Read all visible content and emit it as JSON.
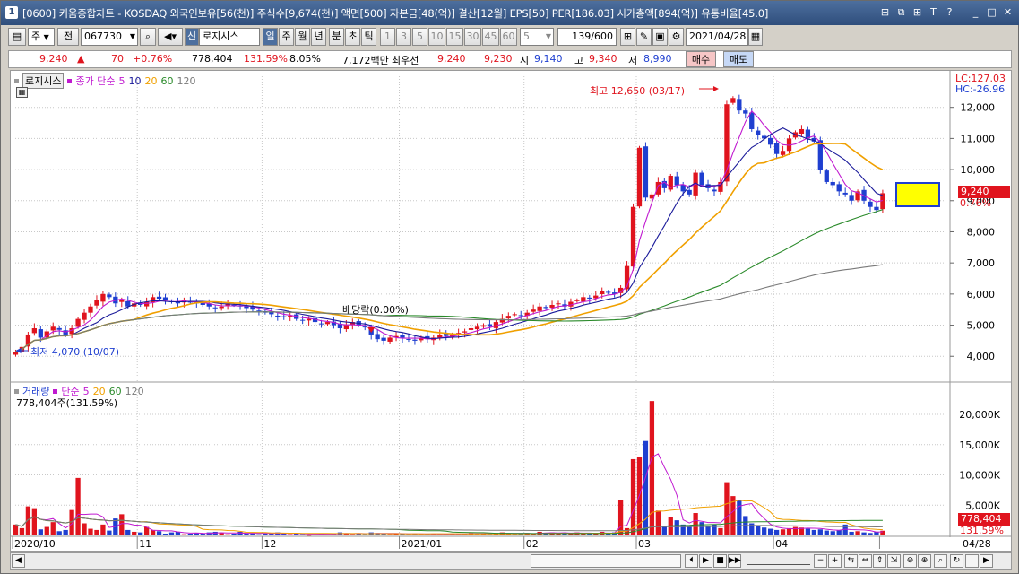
{
  "window": {
    "icon_label": "1",
    "title": "[0600] 키움종합차트 - KOSDAQ 외국인보유[56(천)] 주식수[9,674(천)] 액면[500] 자본금[48(억)] 결산[12월] EPS[50] PER[186.03] 시가총액[894(억)] 유통비율[45.0]",
    "title_buttons": [
      "⊟",
      "⧉",
      "⊞",
      "T",
      "?",
      "_",
      "□",
      "✕"
    ]
  },
  "toolbar": {
    "market_label": "주",
    "prev_label": "전",
    "code_value": "067730",
    "stock_name": "로지시스",
    "new_label": "신",
    "period_buttons": [
      "일",
      "주",
      "월",
      "년",
      "분",
      "초",
      "틱"
    ],
    "minute_buttons": [
      "1",
      "3",
      "5",
      "10",
      "15",
      "30",
      "45",
      "60"
    ],
    "count_value": "5",
    "range_value": "139/600",
    "date_value": "2021/04/28"
  },
  "quote": {
    "price": "9,240",
    "arrow": "▲",
    "change": "70",
    "change_pct": "+0.76%",
    "volume": "778,404",
    "volume_ratio": "131.59%",
    "turnover": "8.05%",
    "amount": "7,172백만",
    "bid_label": "최우선",
    "bid_sell": "9,240",
    "bid_buy": "9,230",
    "open_label": "시",
    "open": "9,140",
    "high_label": "고",
    "high": "9,340",
    "low_label": "저",
    "low": "8,990",
    "buy_btn": "매수",
    "sell_btn": "매도"
  },
  "price_panel": {
    "name_tag": "로지시스",
    "legend_prefix": "종가 단순",
    "ma_labels": [
      "5",
      "10",
      "20",
      "60",
      "120"
    ],
    "lc_label": "LC:127.03",
    "hc_label": "HC:-26.96",
    "high_annot": "최고 12,650 (03/17)",
    "low_annot": "최저 4,070 (10/07)",
    "dividend_annot": "배당락(0.00%)",
    "last_price_tag": "9,240",
    "last_pct_tag": "0.76%"
  },
  "volume_panel": {
    "legend_prefix": "거래량",
    "legend_kind": "단순",
    "ma_labels": [
      "5",
      "20",
      "60",
      "120"
    ],
    "value_line": "778,404주(131.59%)",
    "last_vol_tag": "778,404",
    "last_pct_tag": "131.59%"
  },
  "colors": {
    "up": "#e0141e",
    "down": "#1f3fd0",
    "ma5": "#c01ad0",
    "ma10": "#1a1a9a",
    "ma20": "#f0a000",
    "ma60": "#2a8a2a",
    "ma120": "#7a7a7a"
  },
  "chart_data": {
    "type": "candlestick",
    "y_axis_price": {
      "ticks": [
        4000,
        5000,
        6000,
        7000,
        8000,
        9000,
        10000,
        11000,
        12000
      ],
      "tick_labels": [
        "4,000",
        "5,000",
        "6,000",
        "7,000",
        "8,000",
        "9,000",
        "10,000",
        "11,000",
        "12,000"
      ]
    },
    "y_axis_volume": {
      "ticks": [
        5000,
        10000,
        15000,
        20000
      ],
      "tick_labels": [
        "5,000K",
        "10,000K",
        "15,000K",
        "20,000K"
      ]
    },
    "x_labels": [
      {
        "label": "2020/10",
        "index": 0
      },
      {
        "label": "11",
        "index": 20
      },
      {
        "label": "12",
        "index": 40
      },
      {
        "label": "2021/01",
        "index": 62
      },
      {
        "label": "02",
        "index": 82
      },
      {
        "label": "03",
        "index": 100
      },
      {
        "label": "04",
        "index": 122
      },
      {
        "label": "04/28",
        "index": 139
      }
    ],
    "close": [
      4150,
      4300,
      4700,
      4900,
      4600,
      4800,
      4950,
      4850,
      4700,
      4900,
      5200,
      5400,
      5600,
      5800,
      6000,
      5900,
      5700,
      5800,
      5600,
      5700,
      5650,
      5750,
      5900,
      5850,
      5800,
      5750,
      5700,
      5800,
      5750,
      5700,
      5650,
      5600,
      5550,
      5600,
      5700,
      5650,
      5600,
      5550,
      5500,
      5450,
      5400,
      5350,
      5300,
      5250,
      5300,
      5200,
      5150,
      5200,
      5100,
      5050,
      5100,
      5000,
      4900,
      5000,
      5100,
      5000,
      4950,
      4700,
      4550,
      4500,
      4600,
      4650,
      4600,
      4550,
      4500,
      4600,
      4550,
      4600,
      4700,
      4650,
      4700,
      4750,
      4800,
      4900,
      4950,
      5000,
      4950,
      5100,
      5200,
      5300,
      5350,
      5300,
      5400,
      5500,
      5600,
      5550,
      5650,
      5700,
      5600,
      5750,
      5800,
      5900,
      5850,
      5950,
      6100,
      6050,
      6000,
      6200,
      6900,
      8800,
      10700,
      9100,
      9200,
      9600,
      9400,
      9800,
      9500,
      9300,
      9200,
      9900,
      9500,
      9400,
      9300,
      9600,
      12100,
      12300,
      11900,
      11800,
      11300,
      11100,
      11000,
      10800,
      10500,
      10600,
      11000,
      11200,
      11300,
      11000,
      10900,
      10000,
      9600,
      9500,
      9300,
      9200,
      9000,
      9300,
      9000,
      8800,
      8700,
      9240
    ],
    "volume": [
      1800,
      1200,
      4800,
      4500,
      1000,
      1400,
      2200,
      700,
      900,
      4200,
      9500,
      2000,
      1100,
      900,
      1800,
      800,
      2800,
      3500,
      900,
      600,
      500,
      1400,
      900,
      700,
      300,
      500,
      600,
      200,
      300,
      400,
      300,
      500,
      600,
      400,
      200,
      300,
      600,
      300,
      400,
      200,
      300,
      400,
      500,
      300,
      200,
      300,
      200,
      100,
      200,
      300,
      200,
      300,
      500,
      300,
      200,
      300,
      200,
      500,
      400,
      300,
      200,
      300,
      250,
      200,
      300,
      200,
      200,
      300,
      200,
      200,
      300,
      200,
      300,
      400,
      200,
      300,
      200,
      400,
      500,
      300,
      200,
      300,
      400,
      300,
      600,
      400,
      500,
      300,
      400,
      300,
      500,
      400,
      300,
      300,
      600,
      300,
      500,
      5800,
      1200,
      12600,
      13000,
      15600,
      22200,
      4100,
      1500,
      3000,
      2500,
      1800,
      1500,
      3700,
      2200,
      1500,
      1800,
      1200,
      8800,
      6500,
      5800,
      3200,
      2000,
      1700,
      1300,
      1100,
      900,
      1000,
      1200,
      1400,
      1300,
      1100,
      900,
      1000,
      800,
      700,
      900,
      1800,
      600,
      700,
      500,
      400,
      600,
      778
    ]
  }
}
